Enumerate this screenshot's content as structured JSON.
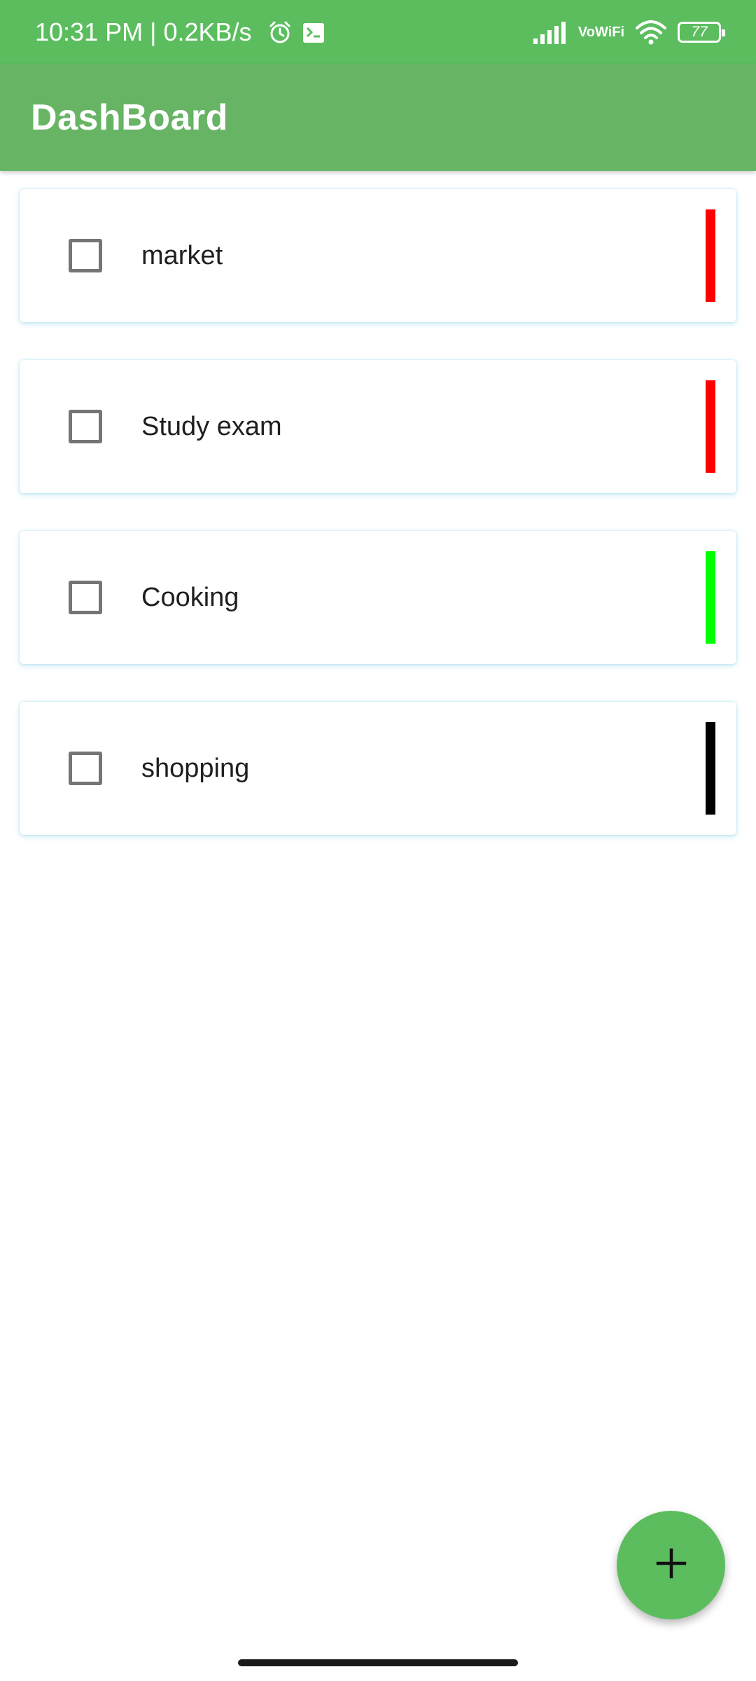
{
  "status_bar": {
    "time": "10:31 PM | 0.2KB/s",
    "vowifi_top": "Vo",
    "vowifi_bottom": "WiFi",
    "battery": "77"
  },
  "app_bar": {
    "title": "DashBoard",
    "background": "#66b464"
  },
  "tasks": [
    {
      "label": "market",
      "priority_color": "#ff0000",
      "checked": false
    },
    {
      "label": "Study exam",
      "priority_color": "#ff0000",
      "checked": false
    },
    {
      "label": "Cooking",
      "priority_color": "#00ff00",
      "checked": false
    },
    {
      "label": "shopping",
      "priority_color": "#000000",
      "checked": false
    }
  ],
  "fab": {
    "icon": "plus-icon",
    "color": "#5cbd5f"
  },
  "colors": {
    "accent": "#5cbd5f"
  }
}
